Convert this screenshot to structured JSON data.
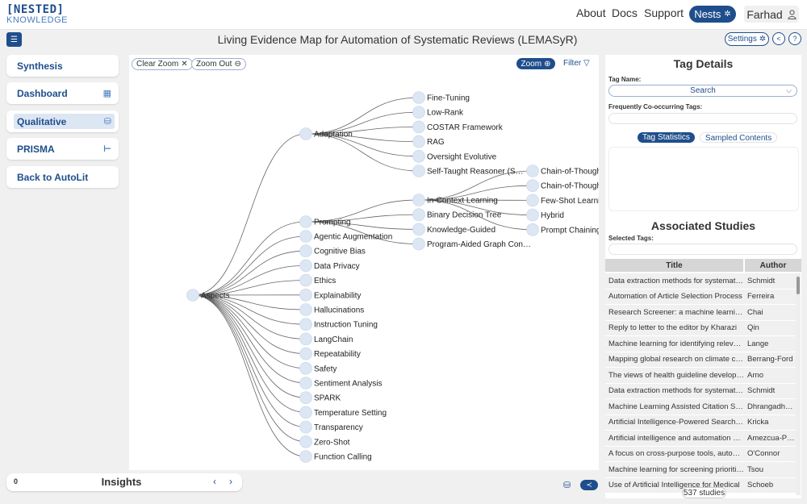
{
  "brand": {
    "line1": "[NESTED]",
    "line2": "KNOWLEDGE"
  },
  "nav": {
    "about": "About",
    "docs": "Docs",
    "support": "Support",
    "nests": "Nests",
    "user": "Farhad"
  },
  "header": {
    "title": "Living Evidence Map for Automation of Systematic Reviews (LEMASyR)",
    "settings": "Settings"
  },
  "sidebar": {
    "items": [
      {
        "label": "Synthesis",
        "icon": ""
      },
      {
        "label": "Dashboard",
        "icon": "dashboard-icon"
      },
      {
        "label": "Qualitative",
        "icon": "qualitative-icon"
      },
      {
        "label": "PRISMA",
        "icon": "prisma-icon"
      },
      {
        "label": "Back to AutoLit",
        "icon": ""
      }
    ]
  },
  "tree_toolbar": {
    "clear_zoom": "Clear Zoom",
    "zoom_out": "Zoom Out",
    "zoom": "Zoom",
    "filter": "Filter"
  },
  "tree": {
    "root": "Aspects",
    "adaptation": "Adaptation",
    "prompting": "Prompting",
    "adaptation_children": [
      "Fine-Tuning",
      "Low-Rank",
      "COSTAR Framework",
      "RAG",
      "Oversight Evolutive",
      "Self-Taught Reasoner (S…"
    ],
    "aspect_children": [
      "Agentic Augmentation",
      "Cognitive Bias",
      "Data Privacy",
      "Ethics",
      "Explainability",
      "Hallucinations",
      "Instruction Tuning",
      "LangChain",
      "Repeatability",
      "Safety",
      "Sentiment Analysis",
      "SPARK",
      "Temperature Setting",
      "Transparency",
      "Zero-Shot",
      "Function Calling"
    ],
    "prompting_children": [
      "In-Context Learning",
      "Binary Decision Tree",
      "Knowledge-Guided",
      "Program-Aided Graph Con…"
    ],
    "icl_children": [
      "Chain-of-Thought",
      "Chain-of-Thought",
      "Few-Shot Learning",
      "Hybrid",
      "Prompt Chaining"
    ]
  },
  "insights": {
    "count": "0",
    "label": "Insights"
  },
  "tag_details": {
    "title": "Tag Details",
    "tag_name_label": "Tag Name:",
    "search_value": "Search",
    "cooccur_label": "Frequently Co-occurring Tags:",
    "tab_stats": "Tag Statistics",
    "tab_samples": "Sampled Contents"
  },
  "assoc": {
    "title": "Associated Studies",
    "selected_label": "Selected Tags:",
    "col_title": "Title",
    "col_author": "Author",
    "rows": [
      {
        "title": "Data extraction methods for systematic reviews",
        "author": "Schmidt"
      },
      {
        "title": "Automation of Article Selection Process",
        "author": "Ferreira"
      },
      {
        "title": "Research Screener: a machine learning tool",
        "author": "Chai"
      },
      {
        "title": "Reply to letter to the editor by Kharazi",
        "author": "Qin"
      },
      {
        "title": "Machine learning for identifying relevant studies",
        "author": "Lange"
      },
      {
        "title": "Mapping global research on climate change",
        "author": "Berrang-Ford"
      },
      {
        "title": "The views of health guideline developers",
        "author": "Arno"
      },
      {
        "title": "Data extraction methods for systematic reviews",
        "author": "Schmidt"
      },
      {
        "title": "Machine Learning Assisted Citation Screening",
        "author": "Dhrangadhariya"
      },
      {
        "title": "Artificial Intelligence-Powered Search Tools",
        "author": "Kricka"
      },
      {
        "title": "Artificial intelligence and automation of reviews",
        "author": "Amezcua-Prieto"
      },
      {
        "title": "A focus on cross-purpose tools, automated",
        "author": "O'Connor"
      },
      {
        "title": "Machine learning for screening prioritization",
        "author": "Tsou"
      },
      {
        "title": "Use of Artificial Intelligence for Medical",
        "author": "Schoeb"
      }
    ],
    "total": "537 studies"
  },
  "colors": {
    "primary": "#1f4e8c",
    "node": "#dde6f3",
    "background": "#f0f0f0"
  }
}
